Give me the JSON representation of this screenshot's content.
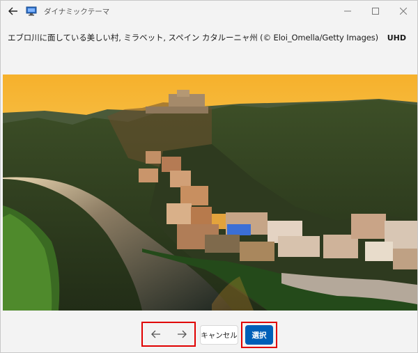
{
  "window": {
    "title": "ダイナミックテーマ"
  },
  "image": {
    "caption": "エブロ川に面している美しい村, ミラベット, スペイン カタルーニャ州 (© Eloi_Omella/Getty Images)",
    "resolution_badge": "UHD"
  },
  "actions": {
    "cancel_label": "キャンセル",
    "select_label": "選択"
  },
  "icons": {
    "back": "back-arrow-icon",
    "app": "monitor-icon",
    "previous": "arrow-left-icon",
    "next": "arrow-right-icon"
  },
  "colors": {
    "accent": "#005fb8",
    "highlight": "#e00000"
  }
}
